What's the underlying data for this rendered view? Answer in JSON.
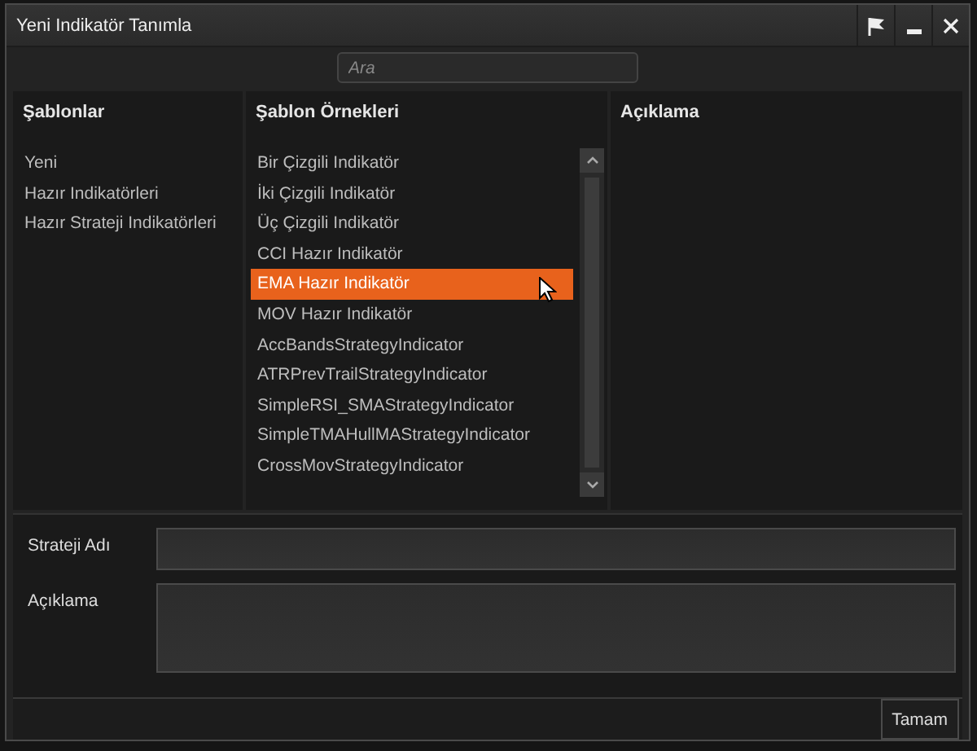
{
  "window": {
    "title": "Yeni Indikatör Tanımla"
  },
  "search": {
    "placeholder": "Ara"
  },
  "panels": [
    {
      "heading": "Şablonlar",
      "items": [
        {
          "label": "Yeni",
          "selected": false
        },
        {
          "label": "Hazır Indikatörleri",
          "selected": false
        },
        {
          "label": "Hazır Strateji Indikatörleri",
          "selected": false
        }
      ]
    },
    {
      "heading": "Şablon Örnekleri",
      "scrollable": true,
      "items": [
        {
          "label": "Bir Çizgili Indikatör",
          "selected": false
        },
        {
          "label": "İki Çizgili Indikatör",
          "selected": false
        },
        {
          "label": "Üç Çizgili Indikatör",
          "selected": false
        },
        {
          "label": "CCI Hazır Indikatör",
          "selected": false
        },
        {
          "label": "EMA Hazır Indikatör",
          "selected": true
        },
        {
          "label": "MOV Hazır Indikatör",
          "selected": false
        },
        {
          "label": "AccBandsStrategyIndicator",
          "selected": false
        },
        {
          "label": "ATRPrevTrailStrategyIndicator",
          "selected": false
        },
        {
          "label": "SimpleRSI_SMAStrategyIndicator",
          "selected": false
        },
        {
          "label": "SimpleTMAHullMAStrategyIndicator",
          "selected": false
        },
        {
          "label": "CrossMovStrategyIndicator",
          "selected": false
        }
      ]
    },
    {
      "heading": "Açıklama"
    }
  ],
  "form": [
    {
      "label": "Strateji Adı",
      "kind": "line"
    },
    {
      "label": "Açıklama",
      "kind": "area"
    }
  ],
  "buttons": [
    "Tamam"
  ]
}
